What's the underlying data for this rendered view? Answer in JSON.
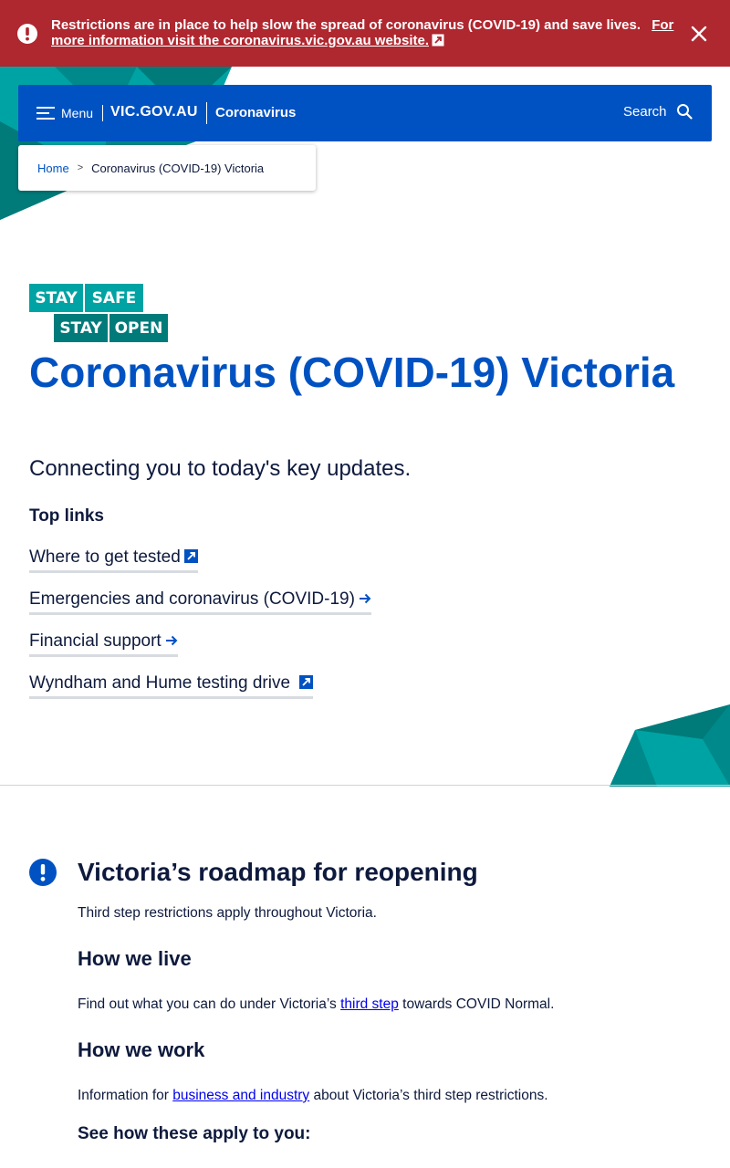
{
  "alert": {
    "message": "Restrictions are in place to help slow the spread of coronavirus (COVID-19) and save lives.",
    "link_text": "For more information visit the coronavirus.vic.gov.au website.",
    "icon": "alert-exclamation-icon",
    "close_icon": "close-icon",
    "background": "#af272f"
  },
  "header": {
    "menu_label": "Menu",
    "logo": "VIC.GOV.AU",
    "site_name": "Coronavirus",
    "search_label": "Search",
    "background": "#0052c2"
  },
  "breadcrumb": {
    "home": "Home",
    "separator": ">",
    "current": "Coronavirus (COVID-19) Victoria"
  },
  "campaign_logo": {
    "row1": [
      "STAY",
      "SAFE"
    ],
    "row2": [
      "STAY",
      "OPEN"
    ]
  },
  "hero": {
    "title": "Coronavirus (COVID-19) Victoria",
    "subtitle": "Connecting you to today's key updates.",
    "top_links_heading": "Top links",
    "links": [
      {
        "label": "Where to get tested",
        "icon": "external-link-icon"
      },
      {
        "label": "Emergencies and coronavirus (COVID-19)",
        "icon": "arrow-right-icon"
      },
      {
        "label": "Financial support",
        "icon": "arrow-right-icon"
      },
      {
        "label": "Wyndham and Hume testing drive",
        "icon": "external-link-icon"
      }
    ]
  },
  "roadmap": {
    "title": "Victoria’s roadmap for reopening",
    "intro": "Third step restrictions apply throughout Victoria.",
    "live_heading": "How we live",
    "live_before": "Find out what you can do under Victoria’s ",
    "live_link": "third step",
    "live_after": " towards COVID Normal.",
    "work_heading": "How we work",
    "work_before": "Information for ",
    "work_link": "business and industry",
    "work_after": " about Victoria’s third step restrictions.",
    "see_heading": "See how these apply to you:"
  },
  "colors": {
    "primary": "#0052c2",
    "text": "#0e1a3d",
    "teal": "#00a3a3",
    "teal_dark": "#007b7a"
  }
}
